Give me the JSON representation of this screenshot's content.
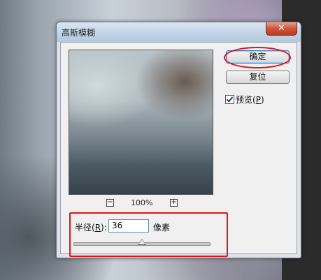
{
  "dialog": {
    "title": "高斯模糊",
    "close_glyph": "✕"
  },
  "preview": {
    "zoom_minus": "−",
    "zoom_level": "100%",
    "zoom_plus": "+"
  },
  "buttons": {
    "ok": "确定",
    "reset": "复位"
  },
  "preview_toggle": {
    "label": "预览",
    "hotkey": "P",
    "checked": true
  },
  "radius": {
    "label": "半径",
    "hotkey": "R",
    "value": "36",
    "unit": "像素",
    "slider_fraction": 0.5
  },
  "colors": {
    "annotation": "#e2121b",
    "close_button": "#d0533a"
  }
}
